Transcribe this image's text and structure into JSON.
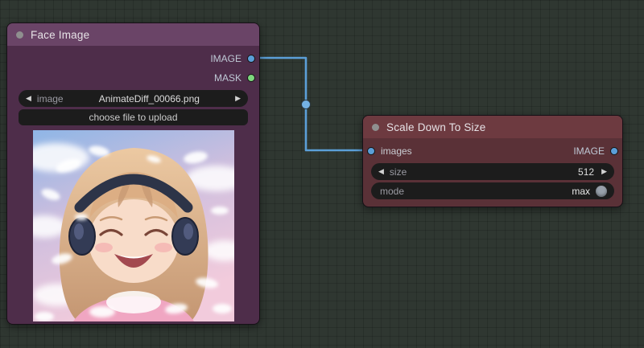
{
  "canvas": {
    "bg": "#2f3731",
    "grid": "#282f29"
  },
  "link": {
    "color": "#5b9fd8"
  },
  "icons": {
    "left_arrow": "◀",
    "right_arrow": "▶",
    "title_dot": "collapse-dot"
  },
  "nodes": {
    "face": {
      "title": "Face Image",
      "outputs": {
        "image": {
          "label": "IMAGE",
          "color": "#5b9fd8"
        },
        "mask": {
          "label": "MASK",
          "color": "#7ed67e"
        }
      },
      "widgets": {
        "image_combo": {
          "label": "image",
          "value": "AnimateDiff_00066.png"
        },
        "upload": {
          "label": "choose file to upload"
        }
      },
      "preview": {
        "description": "anime girl with headphones, closed eyes, smiling, pink and blue sky with white petals"
      }
    },
    "scale": {
      "title": "Scale Down To Size",
      "inputs": {
        "images": {
          "label": "images",
          "color": "#5b9fd8"
        }
      },
      "outputs": {
        "image": {
          "label": "IMAGE",
          "color": "#5b9fd8"
        }
      },
      "widgets": {
        "size": {
          "label": "size",
          "value": "512"
        },
        "mode": {
          "label": "mode",
          "value": "max"
        }
      }
    }
  }
}
